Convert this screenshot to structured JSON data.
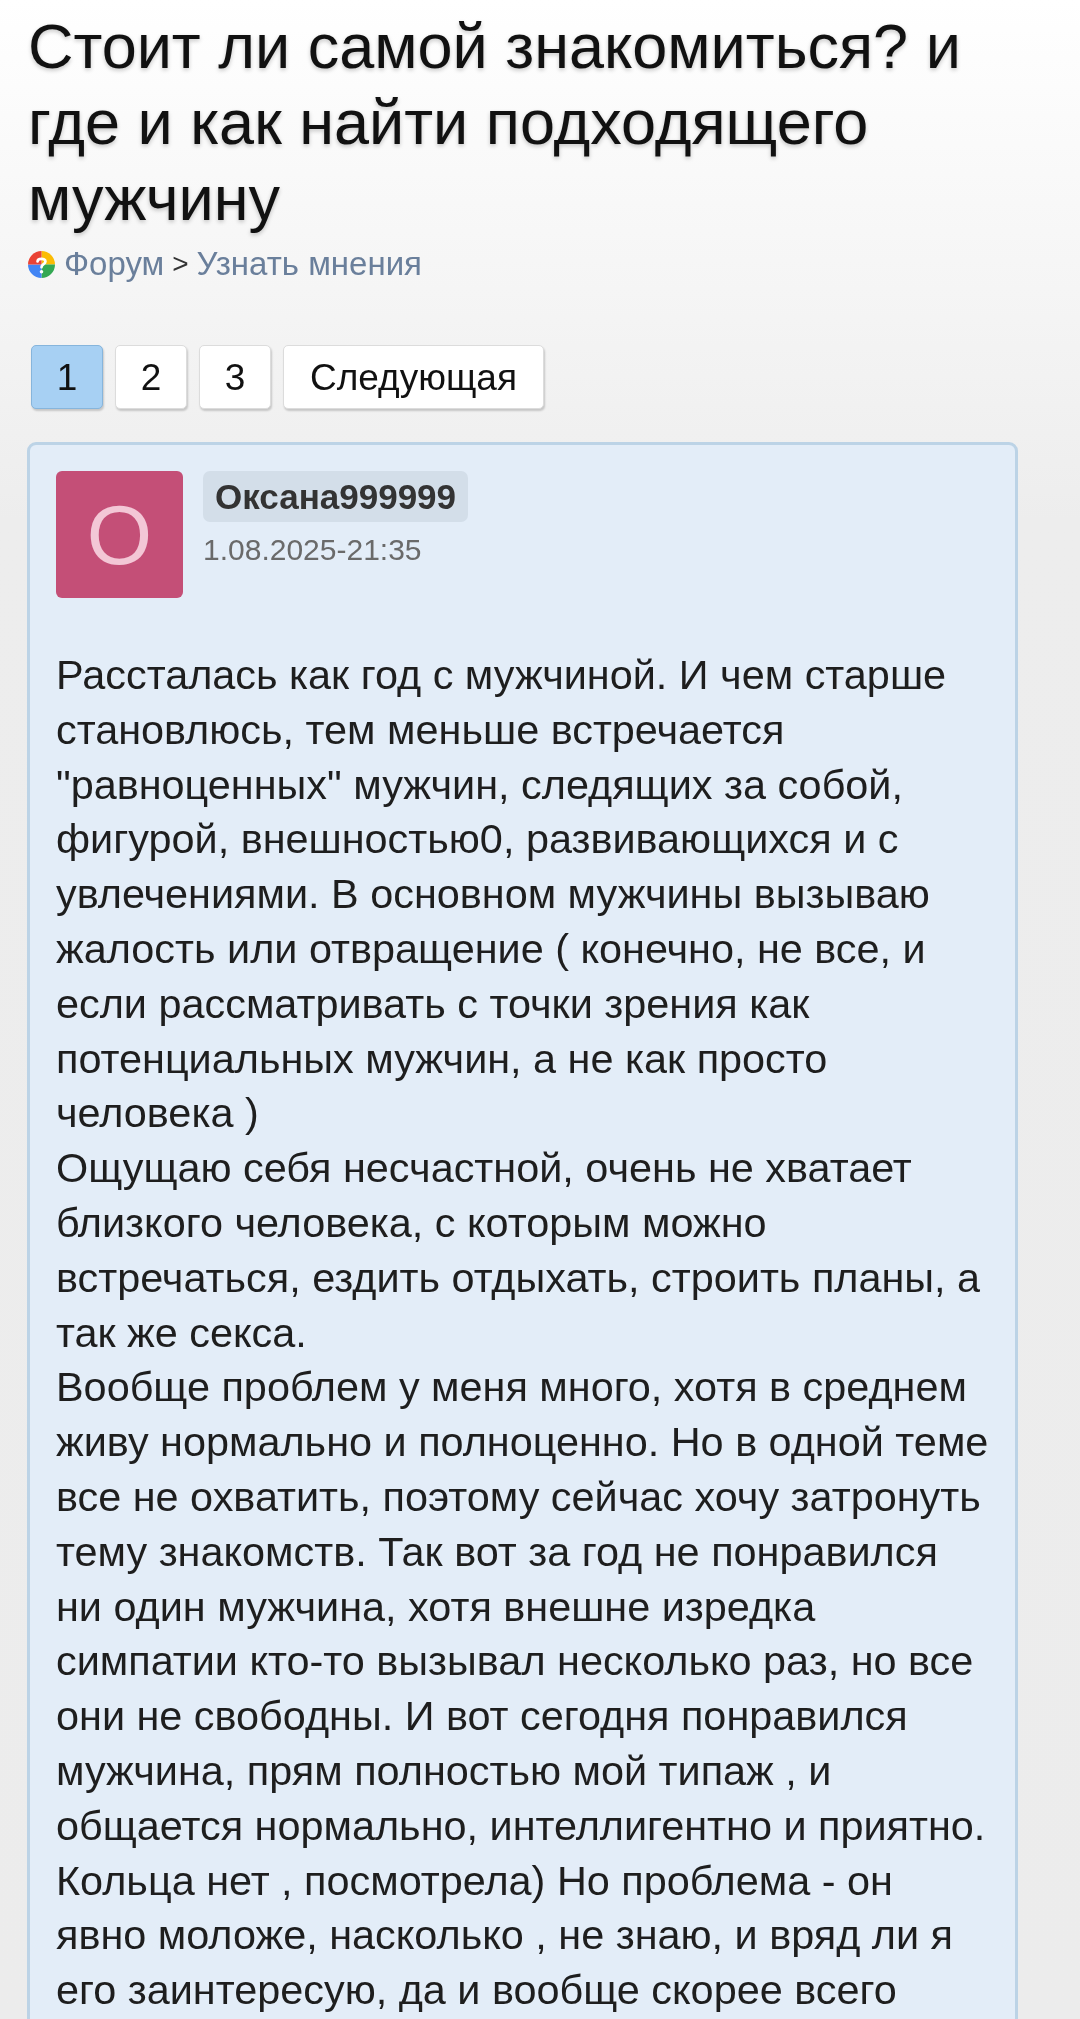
{
  "title": "Стоит ли самой знакомиться? и где и как найти подходящего мужчину",
  "breadcrumb": {
    "items": [
      "Форум",
      "Узнать мнения"
    ],
    "separator": ">"
  },
  "pagination": {
    "pages": [
      {
        "label": "1",
        "selected": true
      },
      {
        "label": "2",
        "selected": false
      },
      {
        "label": "3",
        "selected": false
      }
    ],
    "next": "Следующая"
  },
  "post": {
    "avatar_letter": "О",
    "author": "Оксана999999",
    "date": "1.08.2025-21:35",
    "paragraphs": [
      "Рассталась как год с мужчиной. И чем старше становлюсь, тем меньше встречается \"равноценных\" мужчин, следящих за собой, фигурой, внешностью0, развивающихся и с увлечениями. В основном мужчины вызываю жалость или отвращение ( конечно, не все, и если рассматривать с точки зрения как потенциальных мужчин, а не как просто человека )",
      "Ощущаю себя несчастной, очень не хватает близкого человека, с которым можно встречаться, ездить отдыхать, строить планы, а так же секса.",
      "Вообще проблем у меня много, хотя в среднем живу нормально и полноценно. Но в одной теме все не охватить, поэтому сейчас хочу затронуть тему знакомств. Так вот за год не понравился ни один мужчина, хотя внешне изредка симпатии кто-то вызывал несколько раз, но все они не свободны. И вот сегодня понравился мужчина, прям полностью мой типаж , и общается нормально, интеллигентно и приятно. Кольца нет , посмотрела) Но проблема - он явно моложе, насколько , не знаю, и вряд ли я его заинтересую, да и вообще скорее всего"
    ]
  }
}
